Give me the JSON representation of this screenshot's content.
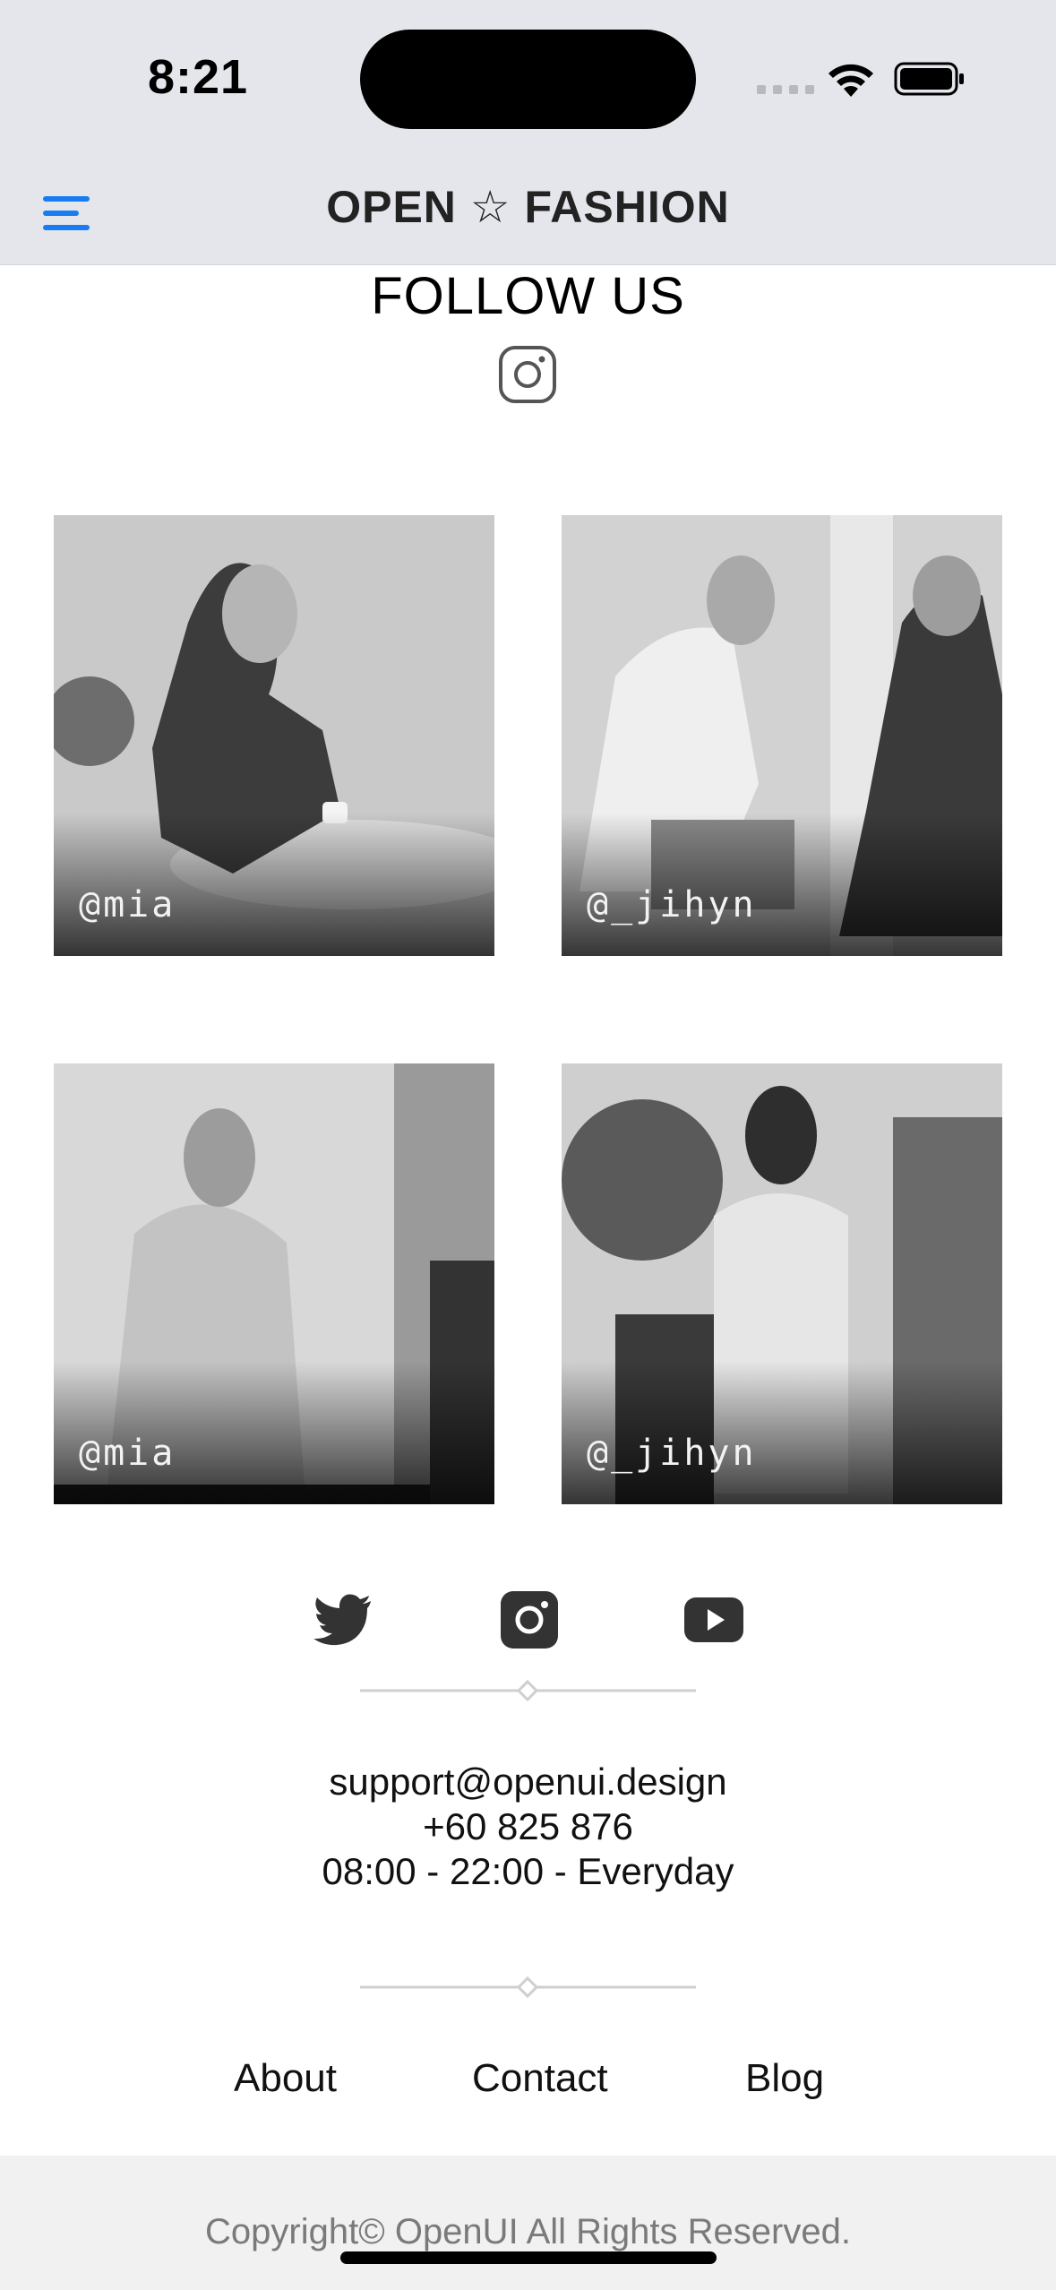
{
  "status_bar": {
    "time": "8:21",
    "icons": [
      "cellular-signal-icon",
      "wifi-icon",
      "battery-icon"
    ]
  },
  "header": {
    "menu_icon": "hamburger-menu-icon",
    "brand": "OPEN ☆ FASHION",
    "accent_color": "#1a7cf2"
  },
  "follow": {
    "title": "FOLLOW US",
    "icon": "instagram-icon"
  },
  "posts": [
    {
      "handle": "@mia"
    },
    {
      "handle": "@_jihyn"
    },
    {
      "handle": "@mia"
    },
    {
      "handle": "@_jihyn"
    }
  ],
  "social_links": [
    {
      "icon": "twitter-icon"
    },
    {
      "icon": "instagram-icon"
    },
    {
      "icon": "youtube-icon"
    }
  ],
  "contact": {
    "email": "support@openui.design",
    "phone": "+60 825 876",
    "hours": "08:00 - 22:00 - Everyday"
  },
  "footer": {
    "links": [
      "About",
      "Contact",
      "Blog"
    ],
    "copyright": "Copyright© OpenUI All Rights Reserved."
  }
}
